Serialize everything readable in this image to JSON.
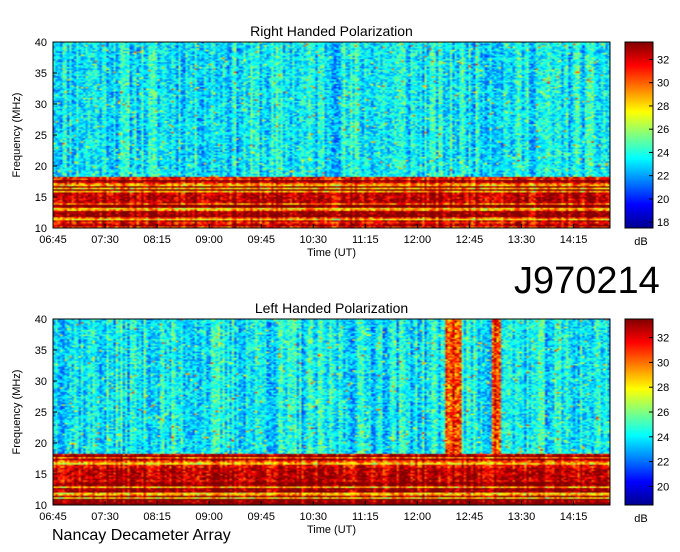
{
  "figure_id": "J970214",
  "footer": "Nancay Decameter Array",
  "colors": {
    "colormap": [
      "#00008f",
      "#0000ff",
      "#0080ff",
      "#00ffff",
      "#80ff80",
      "#ffff00",
      "#ff8000",
      "#ff0000",
      "#800000"
    ]
  },
  "chart_data": [
    {
      "type": "heatmap",
      "title": "Right Handed Polarization",
      "xlabel": "Time (UT)",
      "ylabel": "Frequency (MHz)",
      "x_ticks": [
        "06:45",
        "07:30",
        "08:15",
        "09:00",
        "09:45",
        "10:30",
        "11:15",
        "12:00",
        "12:45",
        "13:30",
        "14:15"
      ],
      "x_range": [
        "06:45",
        "14:45"
      ],
      "y_ticks": [
        10,
        15,
        20,
        25,
        30,
        35,
        40
      ],
      "ylim": [
        10,
        40
      ],
      "colorbar_ticks": [
        18,
        20,
        22,
        24,
        26,
        28,
        30,
        32
      ],
      "colorbar_range": [
        17.5,
        33.5
      ],
      "colorbar_label": "dB"
    },
    {
      "type": "heatmap",
      "title": "Left Handed Polarization",
      "xlabel": "Time (UT)",
      "ylabel": "Frequency (MHz)",
      "x_ticks": [
        "06:45",
        "07:30",
        "08:15",
        "09:00",
        "09:45",
        "10:30",
        "11:15",
        "12:00",
        "12:45",
        "13:30",
        "14:15"
      ],
      "x_range": [
        "06:45",
        "14:45"
      ],
      "y_ticks": [
        10,
        15,
        20,
        25,
        30,
        35,
        40
      ],
      "ylim": [
        10,
        40
      ],
      "colorbar_ticks": [
        20,
        22,
        24,
        26,
        28,
        30,
        32
      ],
      "colorbar_range": [
        18.5,
        33.5
      ],
      "colorbar_label": "dB"
    }
  ]
}
